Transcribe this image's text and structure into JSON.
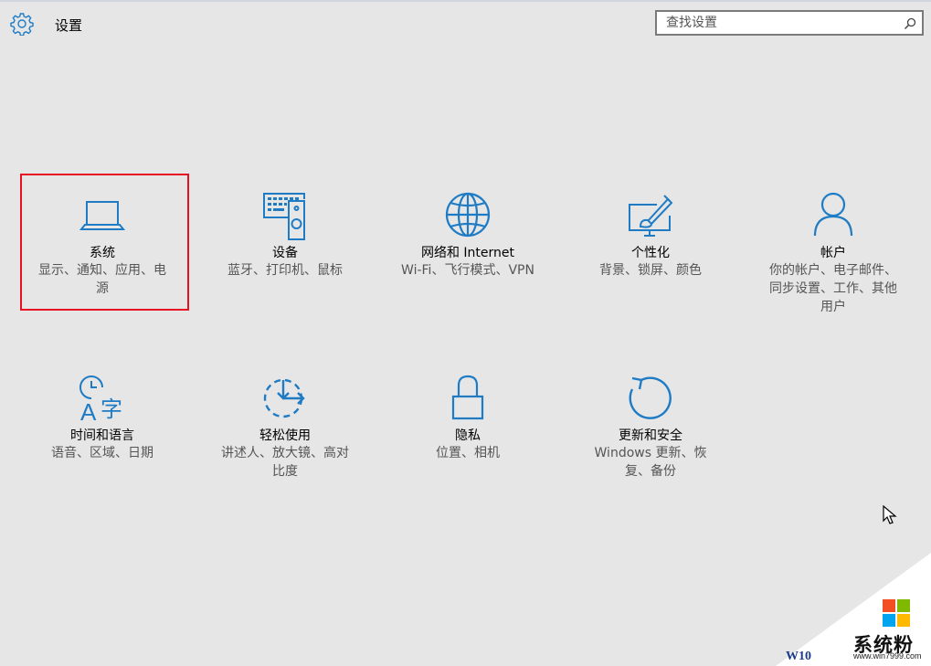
{
  "header": {
    "title": "设置"
  },
  "search": {
    "placeholder": "查找设置"
  },
  "accent_color": "#1e7bc4",
  "tiles": [
    {
      "icon": "laptop-icon",
      "title": "系统",
      "desc_lines": [
        "显示、通知、应用、电",
        "源"
      ]
    },
    {
      "icon": "devices-icon",
      "title": "设备",
      "desc_lines": [
        "蓝牙、打印机、鼠标"
      ]
    },
    {
      "icon": "globe-icon",
      "title": "网络和 Internet",
      "desc_lines": [
        "Wi-Fi、飞行模式、VPN"
      ]
    },
    {
      "icon": "personalization-icon",
      "title": "个性化",
      "desc_lines": [
        "背景、锁屏、颜色"
      ]
    },
    {
      "icon": "account-icon",
      "title": "帐户",
      "desc_lines": [
        "你的帐户、电子邮件、",
        "同步设置、工作、其他",
        "用户"
      ]
    },
    {
      "icon": "time-language-icon",
      "title": "时间和语言",
      "desc_lines": [
        "语音、区域、日期"
      ]
    },
    {
      "icon": "ease-of-access-icon",
      "title": "轻松使用",
      "desc_lines": [
        "讲述人、放大镜、高对",
        "比度"
      ]
    },
    {
      "icon": "lock-icon",
      "title": "隐私",
      "desc_lines": [
        "位置、相机"
      ]
    },
    {
      "icon": "update-icon",
      "title": "更新和安全",
      "desc_lines": [
        "Windows 更新、恢",
        "复、备份"
      ]
    }
  ],
  "tile_icon_text": "字",
  "watermark": {
    "site": "系统粉",
    "url": "www.win7999.com",
    "corner_text": "W10"
  }
}
